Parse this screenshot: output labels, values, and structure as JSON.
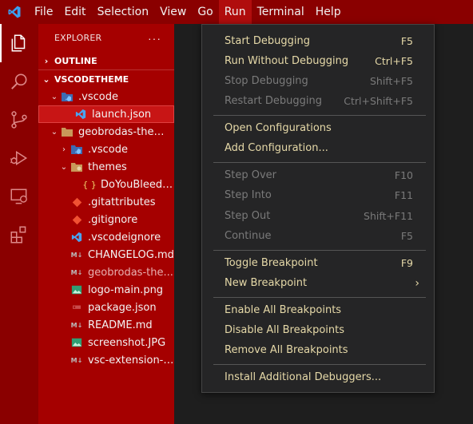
{
  "menubar": {
    "items": [
      {
        "label": "File"
      },
      {
        "label": "Edit"
      },
      {
        "label": "Selection"
      },
      {
        "label": "View"
      },
      {
        "label": "Go"
      },
      {
        "label": "Run"
      },
      {
        "label": "Terminal"
      },
      {
        "label": "Help"
      }
    ],
    "active": "Run"
  },
  "activitybar": {
    "icons": [
      "explorer-icon",
      "search-icon",
      "source-control-icon",
      "run-debug-icon",
      "remote-explorer-icon",
      "extensions-icon"
    ]
  },
  "sidebar": {
    "title": "EXPLORER",
    "more": "···",
    "outline_label": "OUTLINE",
    "workspace_label": "VSCODETHEME",
    "tree": [
      {
        "label": ".vscode"
      },
      {
        "label": "launch.json"
      },
      {
        "label": "geobrodas-theme..."
      },
      {
        "label": ".vscode"
      },
      {
        "label": "themes"
      },
      {
        "label": "DoYouBleed-c..."
      },
      {
        "label": ".gitattributes"
      },
      {
        "label": ".gitignore"
      },
      {
        "label": ".vscodeignore"
      },
      {
        "label": "CHANGELOG.md"
      },
      {
        "label": "geobrodas-the..."
      },
      {
        "label": "logo-main.png"
      },
      {
        "label": "package.json"
      },
      {
        "label": "README.md"
      },
      {
        "label": "screenshot.JPG"
      },
      {
        "label": "vsc-extension-q..."
      }
    ]
  },
  "run_menu": {
    "items": [
      {
        "label": "Start Debugging",
        "shortcut": "F5",
        "enabled": true
      },
      {
        "label": "Run Without Debugging",
        "shortcut": "Ctrl+F5",
        "enabled": true
      },
      {
        "label": "Stop Debugging",
        "shortcut": "Shift+F5",
        "enabled": false
      },
      {
        "label": "Restart Debugging",
        "shortcut": "Ctrl+Shift+F5",
        "enabled": false
      },
      {
        "label": "Open Configurations",
        "shortcut": "",
        "enabled": true
      },
      {
        "label": "Add Configuration...",
        "shortcut": "",
        "enabled": true
      },
      {
        "label": "Step Over",
        "shortcut": "F10",
        "enabled": false
      },
      {
        "label": "Step Into",
        "shortcut": "F11",
        "enabled": false
      },
      {
        "label": "Step Out",
        "shortcut": "Shift+F11",
        "enabled": false
      },
      {
        "label": "Continue",
        "shortcut": "F5",
        "enabled": false
      },
      {
        "label": "Toggle Breakpoint",
        "shortcut": "F9",
        "enabled": true
      },
      {
        "label": "New Breakpoint",
        "shortcut": "",
        "enabled": true
      },
      {
        "label": "Enable All Breakpoints",
        "shortcut": "",
        "enabled": true
      },
      {
        "label": "Disable All Breakpoints",
        "shortcut": "",
        "enabled": true
      },
      {
        "label": "Remove All Breakpoints",
        "shortcut": "",
        "enabled": true
      },
      {
        "label": "Install Additional Debuggers...",
        "shortcut": "",
        "enabled": true
      }
    ]
  },
  "colors": {
    "titlebar": "#8a0000",
    "sidebar": "#a50000",
    "menu_bg": "#252526",
    "menu_text": "#e6d9a8",
    "editor_bg": "#1e1e1e"
  }
}
